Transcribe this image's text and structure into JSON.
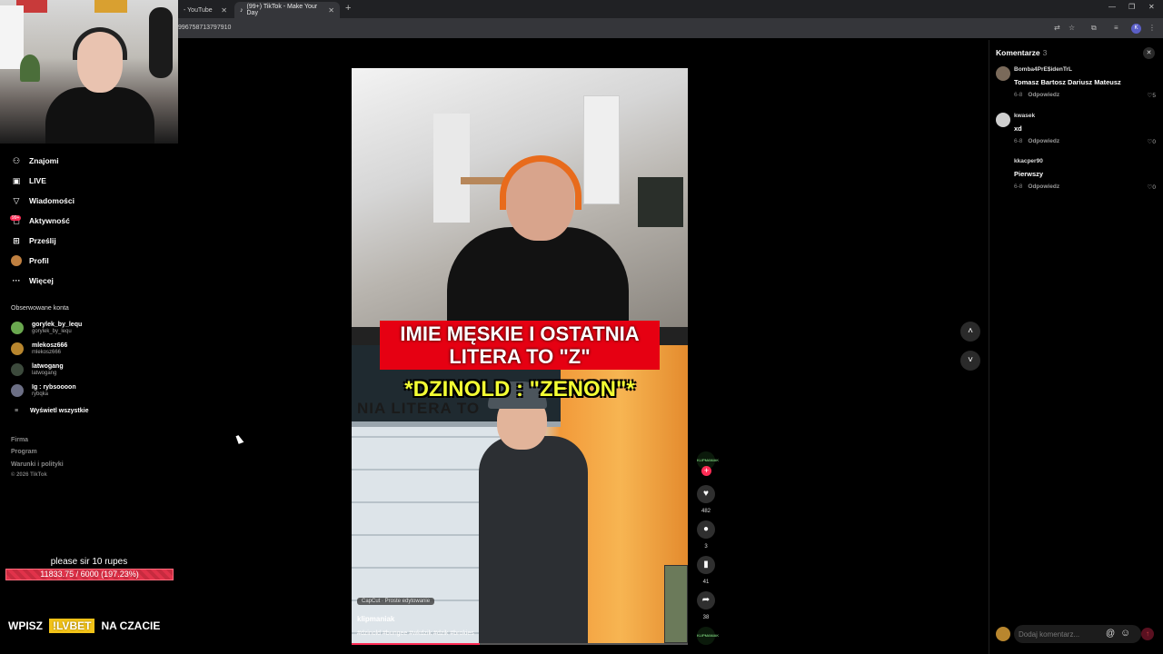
{
  "browser": {
    "tabs": [
      {
        "label": "- YouTube"
      },
      {
        "label": "(99+) TikTok - Make Your Day"
      }
    ],
    "url": "996758713797910"
  },
  "sidebar": {
    "items": [
      {
        "label": "Znajomi",
        "icon": "friends-icon"
      },
      {
        "label": "LIVE",
        "icon": "live-icon"
      },
      {
        "label": "Wiadomości",
        "icon": "messages-icon"
      },
      {
        "label": "Aktywność",
        "icon": "activity-icon"
      },
      {
        "label": "Prześlij",
        "icon": "upload-icon"
      },
      {
        "label": "Profil",
        "icon": "profile-icon"
      },
      {
        "label": "Więcej",
        "icon": "more-icon"
      }
    ],
    "activity_badge": "99+",
    "followed_label": "Obserwowane konta",
    "followed": [
      {
        "name": "gorylek_by_lequ",
        "handle": "gorylek_by_lequ",
        "color": "#6aa84f"
      },
      {
        "name": "mlekosz666",
        "handle": "mlekosz666",
        "color": "#b8862e"
      },
      {
        "name": "latwogang",
        "handle": "latwogang",
        "color": "#3c4a3c"
      },
      {
        "name": "Ig : rybsoooon",
        "handle": "rybqka",
        "color": "#6c6f85"
      }
    ],
    "show_all": "Wyświetl wszystkie",
    "footer": [
      "Firma",
      "Program",
      "Warunki i polityki"
    ],
    "copyright": "© 2026 TikTok"
  },
  "overlay": {
    "donation_text": "please sir 10 rupes",
    "goal_text": "11833.75 / 6000 (197.23%)",
    "goal_progress": 1.0,
    "promo_left": "WPISZ",
    "promo_code": "!LVBET",
    "promo_right": "NA CZACIE"
  },
  "video": {
    "caption_line1": "IMIE MĘSKIE I OSTATNIA",
    "caption_line2": "LITERA TO \"Z\"",
    "caption_yellow": "*DZINOLD : \"ZENON\"*",
    "board_text": "NIA LITERA TO",
    "capcut_label": "CapCut · Proste edytowanie",
    "username": "klipmaniak",
    "hashtags": "#dzinold #bungee #wkdzik #dzik #brokies",
    "progress": 0.38
  },
  "actions": {
    "avatar_label": "KLIPMANIAK",
    "like_count": "482",
    "comment_count": "3",
    "save_count": "41",
    "share_count": "38"
  },
  "comments": {
    "title": "Komentarze",
    "count": "3",
    "items": [
      {
        "user": "Bomba4PrE$idenTrL",
        "text": "Tomasz Bartosz Dariusz Mateusz",
        "date": "6-8",
        "reply": "Odpowiedz",
        "likes": "5",
        "color": "#7a6a5a"
      },
      {
        "user": "kwasek",
        "text": "xd",
        "date": "6-8",
        "reply": "Odpowiedz",
        "likes": "0",
        "color": "#cfcfcf"
      },
      {
        "user": "kkacper90",
        "text": "Pierwszy",
        "date": "6-8",
        "reply": "Odpowiedz",
        "likes": "0",
        "color": "#000000"
      }
    ],
    "input_placeholder": "Dodaj komentarz..."
  }
}
